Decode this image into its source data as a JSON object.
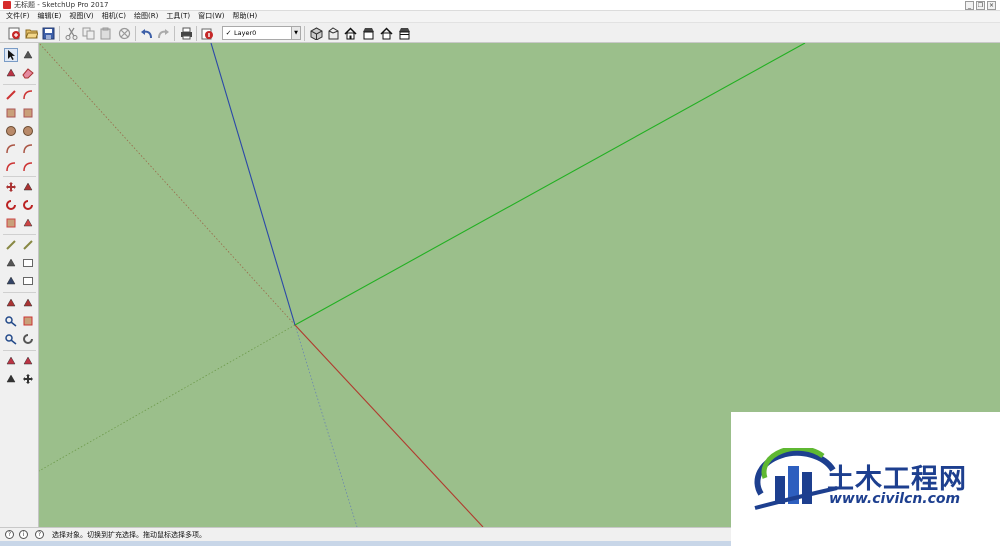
{
  "window": {
    "title": "无标题 - SketchUp Pro 2017",
    "controls": [
      "minimize-icon",
      "restore-icon",
      "close-icon"
    ]
  },
  "menubar": {
    "items": [
      "文件(F)",
      "编辑(E)",
      "视图(V)",
      "相机(C)",
      "绘图(R)",
      "工具(T)",
      "窗口(W)",
      "帮助(H)"
    ]
  },
  "toolbar": {
    "icons": [
      "new-model-icon",
      "open-icon",
      "save-icon",
      "cut-icon",
      "copy-icon",
      "paste-icon",
      "erase-icon",
      "undo-icon",
      "redo-icon",
      "print-icon",
      "model-info-icon",
      "iso-view-icon",
      "top-view-icon",
      "front-view-icon",
      "right-view-icon",
      "back-view-icon",
      "left-view-icon"
    ],
    "layer": {
      "value": "Layer0",
      "check": "✓"
    }
  },
  "left_toolbar": {
    "tools": [
      "select-icon",
      "make-component-icon",
      "paint-bucket-icon",
      "eraser-icon",
      "line-icon",
      "freehand-icon",
      "rectangle-icon",
      "rotated-rectangle-icon",
      "circle-icon",
      "polygon-icon",
      "arc-icon",
      "two-point-arc-icon",
      "three-point-arc-icon",
      "pie-icon",
      "move-icon",
      "push-pull-icon",
      "rotate-icon",
      "follow-me-icon",
      "scale-icon",
      "offset-icon",
      "tape-measure-icon",
      "dimension-icon",
      "protractor-icon",
      "text-icon",
      "axes-icon",
      "3d-text-icon",
      "section-plane-icon",
      "walk-icon",
      "zoom-icon",
      "zoom-window-icon",
      "zoom-extents-icon",
      "orbit-icon",
      "position-camera-icon",
      "look-around-icon",
      "footprints-icon",
      "pan-icon"
    ]
  },
  "viewport": {
    "background": "#9bbf8b",
    "axis_colors": {
      "red": "#b03a2e",
      "green": "#22b022",
      "blue": "#2b48a8"
    }
  },
  "status": {
    "message": "选择对象。切换到扩充选择。拖动鼠标选择多项。"
  },
  "watermark": {
    "text": "土木工程网",
    "url": "www.civilcn.com"
  }
}
